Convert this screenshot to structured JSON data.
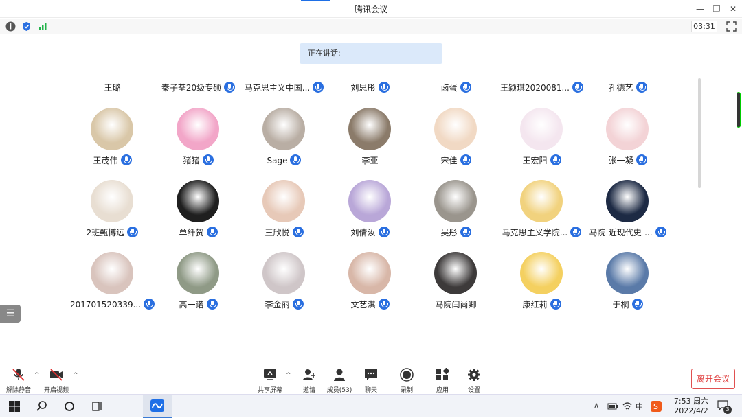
{
  "window": {
    "title": "腾讯会议",
    "minimize": "—",
    "restore": "❐",
    "close": "✕"
  },
  "infobar": {
    "timer": "03:31",
    "icons": [
      "info-icon",
      "shield-icon",
      "signal-icon"
    ]
  },
  "speaking": {
    "label": "正在讲话:"
  },
  "top_row": [
    "王璐",
    "秦子荃20级专硕",
    "马克思主义中国...",
    "刘思彤",
    "卤蛋",
    "王颖琪2020081...",
    "孔德艺"
  ],
  "top_row_mic": [
    false,
    true,
    true,
    true,
    true,
    true,
    true
  ],
  "participants": [
    [
      {
        "name": "王茂伟",
        "mic": true
      },
      {
        "name": "猪猪",
        "mic": true
      },
      {
        "name": "Sage",
        "mic": true
      },
      {
        "name": "李亚",
        "mic": false
      },
      {
        "name": "宋佳",
        "mic": true
      },
      {
        "name": "王宏阳",
        "mic": true
      },
      {
        "name": "张一凝",
        "mic": true
      }
    ],
    [
      {
        "name": "2班甄博远",
        "mic": true
      },
      {
        "name": "单纤贺",
        "mic": true
      },
      {
        "name": "王欣悦",
        "mic": true
      },
      {
        "name": "刘倩汝",
        "mic": true
      },
      {
        "name": "吴彤",
        "mic": true
      },
      {
        "name": "马克思主义学院...",
        "mic": true
      },
      {
        "name": "马院-近现代史-...",
        "mic": true
      }
    ],
    [
      {
        "name": "201701520339...",
        "mic": true
      },
      {
        "name": "高一诺",
        "mic": true
      },
      {
        "name": "李金丽",
        "mic": true
      },
      {
        "name": "文艺淇",
        "mic": true
      },
      {
        "name": "马院闫尚卿",
        "mic": false
      },
      {
        "name": "康红莉",
        "mic": true
      },
      {
        "name": "于桐",
        "mic": true
      }
    ]
  ],
  "avatar_colors": [
    [
      "#d9c7a8",
      "#f2a6c8",
      "#b9aea4",
      "#8b7b6a",
      "#f1d9c4",
      "#f4e6ef",
      "#f3d3d6"
    ],
    [
      "#e8ded2",
      "#1f1f1f",
      "#e7c9b8",
      "#b9a7d8",
      "#9a958d",
      "#f1d27e",
      "#1d2a44"
    ],
    [
      "#d9c4bd",
      "#8f9a86",
      "#cfc6c8",
      "#d8b7a8",
      "#3d3a3a",
      "#f4d060",
      "#5a7aa8"
    ]
  ],
  "toolbar": {
    "unmute": "解除静音",
    "start_video": "开启视频",
    "share": "共享屏幕",
    "invite": "邀请",
    "members": "成员(53)",
    "chat": "聊天",
    "record": "录制",
    "apps": "应用",
    "settings": "设置",
    "leave": "离开会议"
  },
  "taskbar": {
    "time": "7:53 周六",
    "date": "2022/4/2",
    "ime": "中",
    "notif_count": "3"
  }
}
